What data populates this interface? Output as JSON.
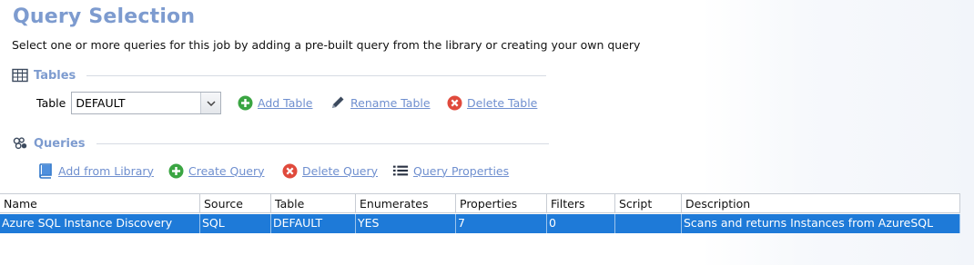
{
  "header": {
    "title": "Query Selection",
    "subtitle": "Select one or more queries for this job by adding a pre-built query from the library or creating your own query"
  },
  "tables_section": {
    "label": "Tables",
    "table_label": "Table",
    "table_value": "DEFAULT",
    "add": "Add Table",
    "rename": "Rename Table",
    "delete": "Delete Table"
  },
  "queries_section": {
    "label": "Queries",
    "add_library": "Add from Library",
    "create": "Create Query",
    "delete": "Delete Query",
    "properties": "Query Properties"
  },
  "grid": {
    "columns": [
      "Name",
      "Source",
      "Table",
      "Enumerates",
      "Properties",
      "Filters",
      "Script",
      "Description"
    ],
    "rows": [
      [
        "Azure SQL Instance Discovery",
        "SQL",
        "DEFAULT",
        "YES",
        "7",
        "0",
        "",
        "Scans and returns Instances from AzureSQL"
      ]
    ]
  },
  "colors": {
    "accent": "#7d9bcf",
    "link": "#6f8fcf",
    "selection": "#1e7ad8",
    "green": "#3aa542",
    "red": "#e04a3c"
  },
  "icons": [
    "table-grid-icon",
    "queries-icon",
    "add-icon",
    "pencil-icon",
    "delete-icon",
    "book-icon",
    "list-icon",
    "chevron-down-icon"
  ]
}
